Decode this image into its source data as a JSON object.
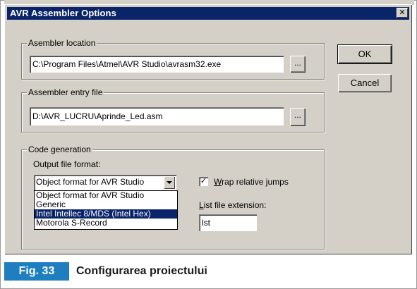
{
  "dialog": {
    "title": "AVR Assembler Options",
    "close_label": "✕"
  },
  "assembler_location": {
    "group_label": "Asembler location",
    "value": "C:\\Program Files\\Atmel\\AVR Studio\\avrasm32.exe",
    "browse_label": "..."
  },
  "assembler_entry": {
    "group_label": "Assembler entry file",
    "value": "D:\\AVR_LUCRU\\Aprinde_Led.asm",
    "browse_label": "..."
  },
  "code_generation": {
    "group_label": "Code generation",
    "output_format_label": "Output file format:",
    "selected_format": "Object format for AVR Studio",
    "options": [
      "Object format for AVR Studio",
      "Generic",
      "Intel Intellec 8/MDS (Intel Hex)",
      "Motorola S-Record"
    ],
    "wrap_label_prefix": "W",
    "wrap_label_rest": "rap relative jumps",
    "wrap_checked_mark": "✓",
    "list_ext_label_prefix": "L",
    "list_ext_label_rest": "ist file extension:",
    "list_ext_value": "lst"
  },
  "buttons": {
    "ok": "OK",
    "cancel": "Cancel"
  },
  "caption": {
    "tag": "Fig. 33",
    "text": "Configurarea proiectului"
  },
  "colors": {
    "titlebar": "#0a246a",
    "face": "#d4d0c8",
    "fig_tag": "#1f7ec0"
  }
}
